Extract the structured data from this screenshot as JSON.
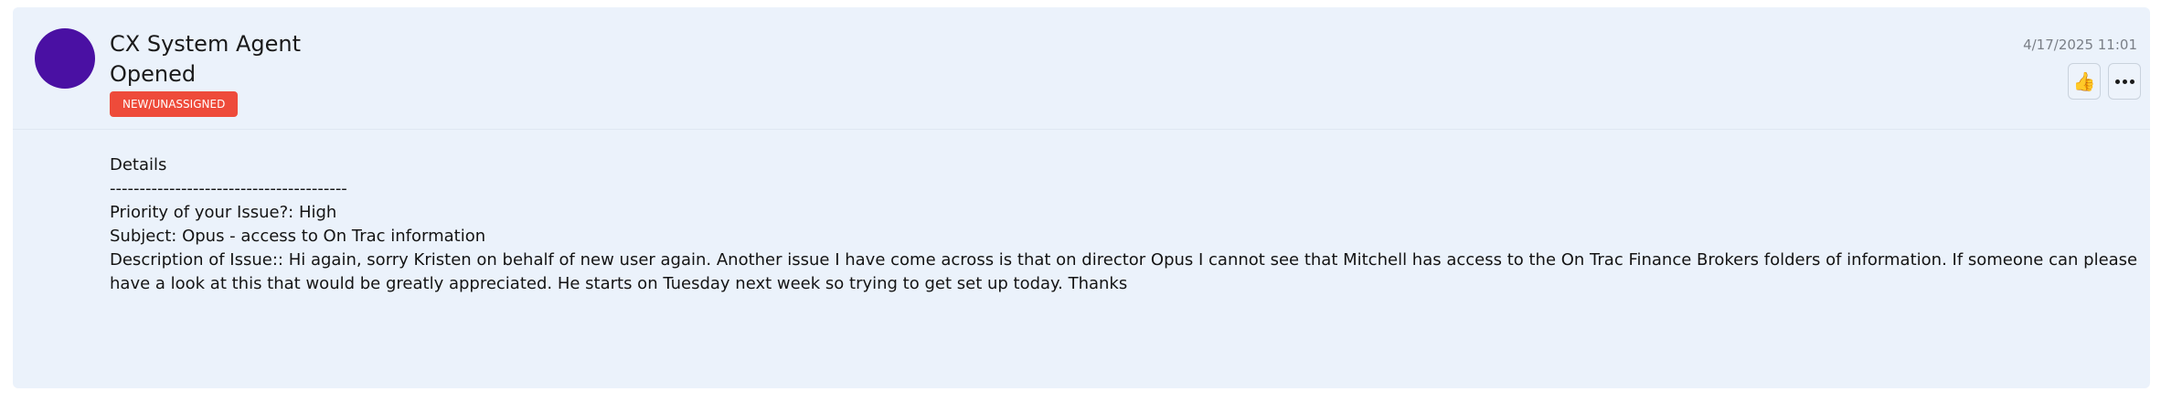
{
  "message": {
    "sender_name": "CX System Agent",
    "status_text": "Opened",
    "badge_label": "NEW/UNASSIGNED",
    "timestamp": "4/17/2025 11:01",
    "avatar_color": "#4a10a3",
    "badge_color": "#ee4b3a",
    "like_icon": "thumbs-up-icon",
    "more_icon": "more-horizontal-icon",
    "body": {
      "heading": "Details",
      "divider": "----------------------------------------",
      "priority": "Priority of your Issue?: High",
      "subject": "Subject: Opus - access to On Trac information",
      "description": "Description of Issue:: Hi again, sorry Kristen on behalf of new user again. Another issue I have come across is that on director Opus I cannot see that Mitchell has access to the On Trac Finance Brokers folders of information. If someone can please have a look at this that would be greatly appreciated. He starts on Tuesday next week so trying to get set up today. Thanks"
    }
  }
}
